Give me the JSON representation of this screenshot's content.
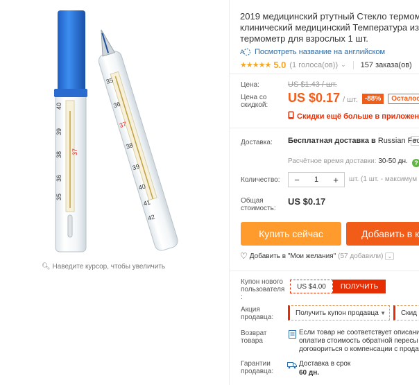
{
  "product": {
    "title_lines": [
      "2019 медицинский ртутный Стекло термометр",
      "клинический медицинский Температура изм",
      "термометр для взрослых 1 шт."
    ],
    "translate_link": "Посмотреть название на английском",
    "stars": "★★★★★",
    "rating": "5.0",
    "votes": "(1 голоса(ов))",
    "orders": "157 заказа(ов)"
  },
  "gallery": {
    "zoom_hint": "Наведите курсор, чтобы увеличить"
  },
  "pricing": {
    "price_label": "Цена:",
    "old_price": "US $1.43 / шт.",
    "discount_price_label": "Цена со скидкой:",
    "price": "US $0.17",
    "per_unit": "/ шт.",
    "discount": "-88%",
    "left_badge": "Осталось",
    "app_discount": "Скидки ещё больше в приложении"
  },
  "shipping": {
    "label": "Доставка:",
    "free_text": "Бесплатная доставка в",
    "country": "Russian Federa",
    "eta_label": "Расчётное время доставки:",
    "eta_value": "30-50 дн."
  },
  "quantity": {
    "label": "Количество:",
    "minus": "−",
    "value": "1",
    "plus": "+",
    "hint": "шт. (1 шт. - максимум"
  },
  "total": {
    "label": "Общая стоимость:",
    "value": "US $0.17"
  },
  "actions": {
    "buy_now": "Купить сейчас",
    "add_to_cart": "Добавить в к"
  },
  "wishlist": {
    "label": "Добавить в \"Мои желания\"",
    "count": "(57 добавили)"
  },
  "coupons": {
    "new_user_label": "Купон нового пользователя :",
    "new_user_value": "US $4.00",
    "new_user_get": "ПОЛУЧИТЬ",
    "seller_label": "Акция продавца:",
    "seller_select": "Получить купон продавца",
    "seller_second": "Скид"
  },
  "returns": {
    "label": "Возврат товара",
    "lines": [
      "Если товар не соответствует описани",
      "оплатив стоимость обратной пересы",
      "договориться о компенсации с прода"
    ]
  },
  "guarantees": {
    "label": "Гарантии продавца:",
    "line1": "Доставка в срок",
    "line2": "60 дн."
  },
  "colors": {
    "accent_orange": "#f25c19",
    "buy_orange": "#ff9a2c",
    "red": "#e62e04",
    "link_blue": "#2b6ba6",
    "star_gold": "#f5a623"
  }
}
